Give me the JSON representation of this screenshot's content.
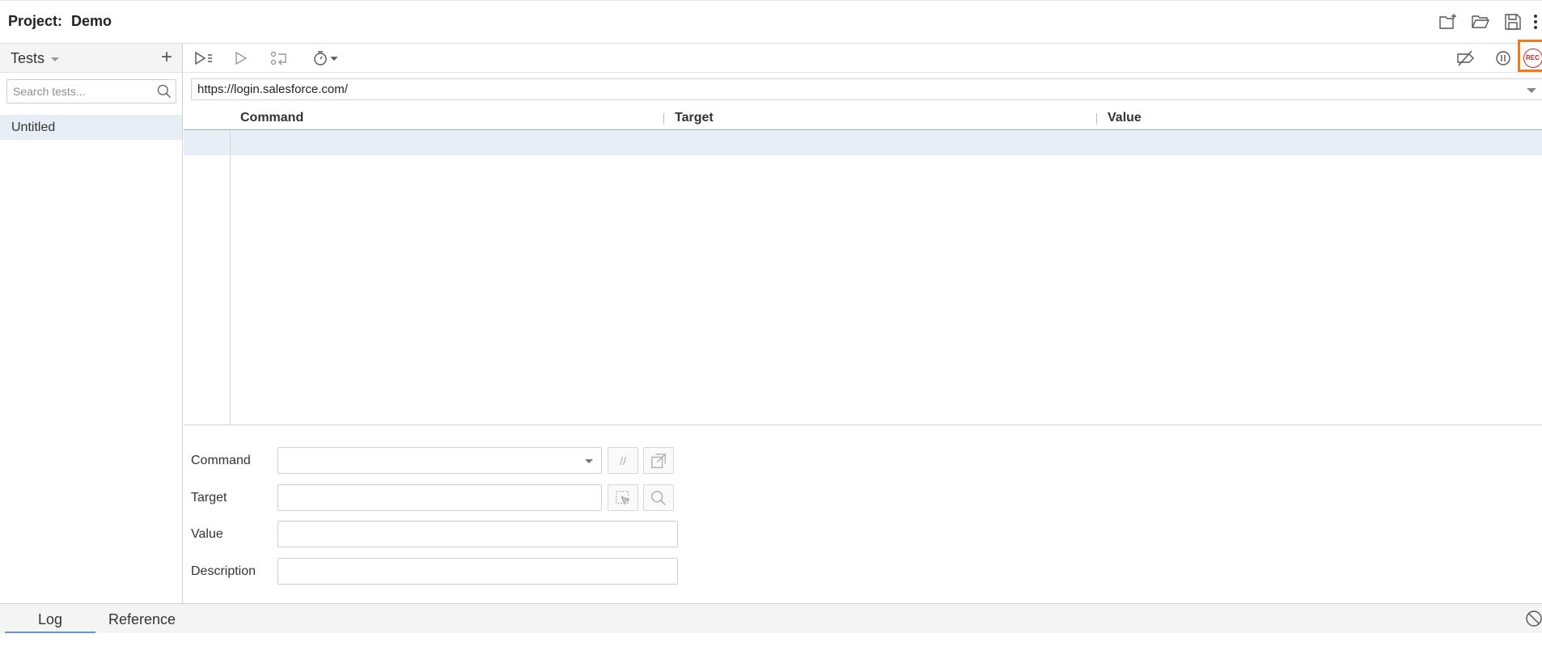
{
  "header": {
    "project_label": "Project:",
    "project_name": "Demo",
    "icons": [
      "new-project-icon",
      "open-folder-icon",
      "save-icon",
      "more-vert-icon"
    ]
  },
  "sidebar": {
    "title": "Tests",
    "add_symbol": "+",
    "search_placeholder": "Search tests...",
    "items": [
      {
        "label": "Untitled",
        "selected": true
      }
    ]
  },
  "toolbar": {
    "left_icons": [
      "run-all-tests-icon",
      "run-test-icon",
      "step-over-icon",
      "speed-timer-icon"
    ],
    "right_icons": [
      "disable-breakpoints-icon",
      "pause-on-exceptions-icon",
      "record-icon"
    ],
    "record_text": "REC"
  },
  "url": {
    "value": "https://login.salesforce.com/"
  },
  "grid": {
    "columns": [
      "Command",
      "Target",
      "Value"
    ],
    "rows": []
  },
  "editor": {
    "command_label": "Command",
    "target_label": "Target",
    "value_label": "Value",
    "description_label": "Description",
    "command_value": "",
    "target_value": "",
    "value_value": "",
    "description_value": "",
    "comment_symbol": "//"
  },
  "bottom": {
    "tabs": [
      "Log",
      "Reference"
    ],
    "active_tab": "Log"
  },
  "colors": {
    "record_border": "#f07a1a",
    "record_red": "#c62828",
    "selection": "#e7eef6",
    "tab_underline": "#5b9bd5"
  }
}
